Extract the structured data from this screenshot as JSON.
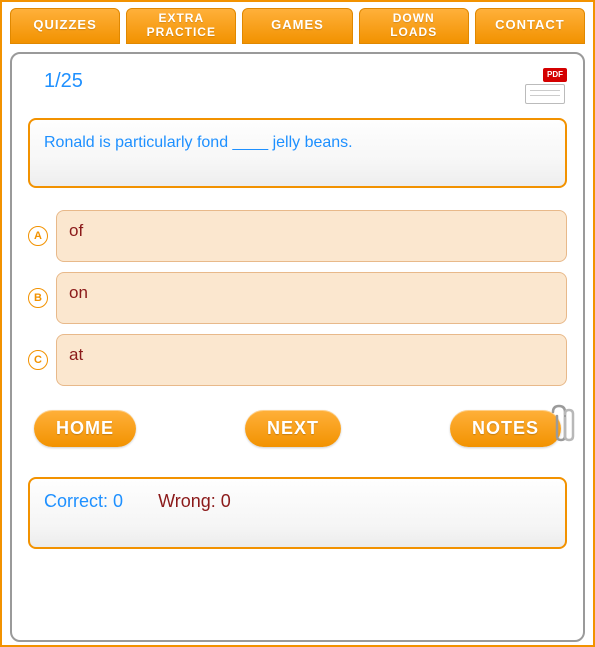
{
  "tabs": {
    "quizzes": "QUIZZES",
    "extra_practice_l1": "EXTRA",
    "extra_practice_l2": "PRACTICE",
    "games": "GAMES",
    "downloads_l1": "DOWN",
    "downloads_l2": "LOADS",
    "contact": "CONTACT"
  },
  "counter": "1/25",
  "pdf_label": "PDF",
  "question": "Ronald is particularly fond ____ jelly beans.",
  "options": {
    "a_letter": "A",
    "a_text": "of",
    "b_letter": "B",
    "b_text": "on",
    "c_letter": "C",
    "c_text": "at"
  },
  "buttons": {
    "home": "HOME",
    "next": "NEXT",
    "notes": "NOTES"
  },
  "score": {
    "correct_label": "Correct:",
    "correct_value": "0",
    "wrong_label": "Wrong:",
    "wrong_value": "0"
  }
}
